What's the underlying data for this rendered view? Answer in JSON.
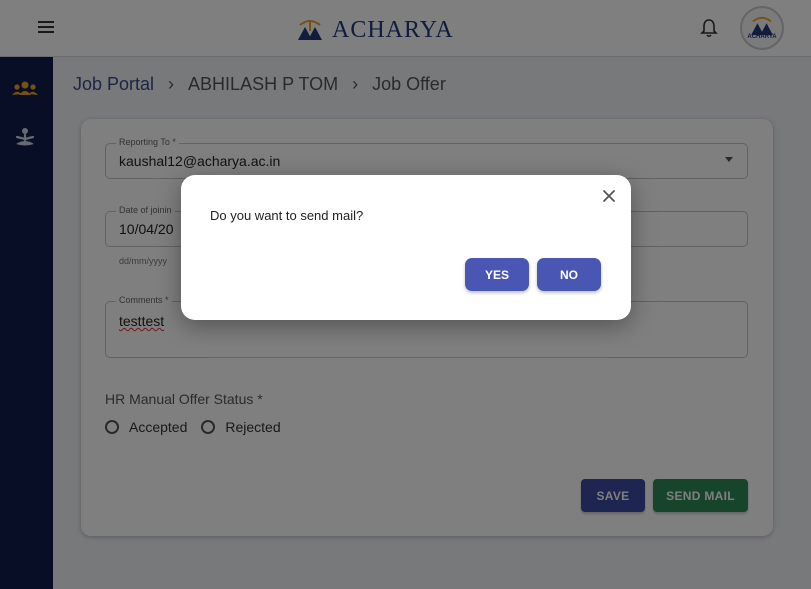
{
  "header": {
    "brand": "ACHARYA",
    "avatar_text": "ACHARYA"
  },
  "breadcrumb": {
    "items": [
      "Job Portal",
      "ABHILASH P TOM",
      "Job Offer"
    ],
    "separator": "›"
  },
  "form": {
    "reporting_to": {
      "label": "Reporting To *",
      "value": "kaushal12@acharya.ac.in"
    },
    "date_of_joining": {
      "label": "Date of joinin",
      "value": "10/04/20",
      "helper": "dd/mm/yyyy"
    },
    "comments": {
      "label": "Comments *",
      "value": "testtest"
    },
    "hr_status": {
      "label": "HR Manual Offer Status *",
      "options": [
        "Accepted",
        "Rejected"
      ]
    },
    "save_label": "SAVE",
    "send_mail_label": "SEND MAIL"
  },
  "dialog": {
    "message": "Do you want to send mail?",
    "yes_label": "YES",
    "no_label": "NO"
  },
  "colors": {
    "sidebar": "#0f1d4c",
    "brand": "#243a7a",
    "primary_button": "#4a56b4",
    "save_button": "#3b4aa0",
    "send_mail_button": "#2e8b57",
    "icon_accent": "#f0a020"
  }
}
